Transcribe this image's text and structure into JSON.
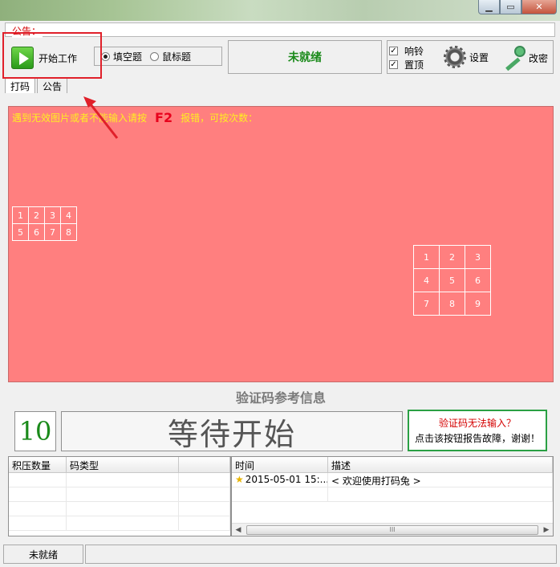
{
  "notice": {
    "label": "公告："
  },
  "toolbar": {
    "start_label": "开始工作",
    "radio_options": [
      {
        "label": "填空题",
        "selected": true
      },
      {
        "label": "鼠标题",
        "selected": false
      }
    ],
    "status": "未就绪",
    "checkboxes": [
      {
        "label": "响铃",
        "checked": true
      },
      {
        "label": "置顶",
        "checked": true
      }
    ],
    "settings_label": "设置",
    "change_pwd_label": "改密"
  },
  "tabs": [
    {
      "label": "打码",
      "active": true
    },
    {
      "label": "公告",
      "active": false
    }
  ],
  "panel": {
    "message_prefix": "遇到无效图片或者不能输入请按",
    "message_key": "F2",
    "message_suffix": "报错，可按次数：",
    "grid_small": [
      "1",
      "2",
      "3",
      "4",
      "5",
      "6",
      "7",
      "8"
    ],
    "grid_large": [
      "1",
      "2",
      "3",
      "4",
      "5",
      "6",
      "7",
      "8",
      "9"
    ]
  },
  "reference": {
    "title": "验证码参考信息",
    "countdown": "10",
    "wait_text": "等待开始",
    "report_line1": "验证码无法输入？",
    "report_line2": "点击该按钮报告故障，谢谢！"
  },
  "left_table": {
    "columns": [
      "积压数量",
      "码类型",
      ""
    ]
  },
  "log_table": {
    "columns": [
      "时间",
      "描述"
    ],
    "rows": [
      {
        "time": "2015-05-01 15:...",
        "desc": "< 欢迎使用打码兔 >"
      }
    ],
    "scroll_thumb": "III"
  },
  "statusbar": {
    "status": "未就绪"
  },
  "colors": {
    "panel_bg": "#ff7f7f",
    "status_green": "#1a8a1a",
    "annotation_red": "#e0202a",
    "f2_red": "#e8001c",
    "message_yellow": "#ffee22"
  },
  "icons": [
    "play-icon",
    "gear-icon",
    "key-icon",
    "star-icon"
  ]
}
